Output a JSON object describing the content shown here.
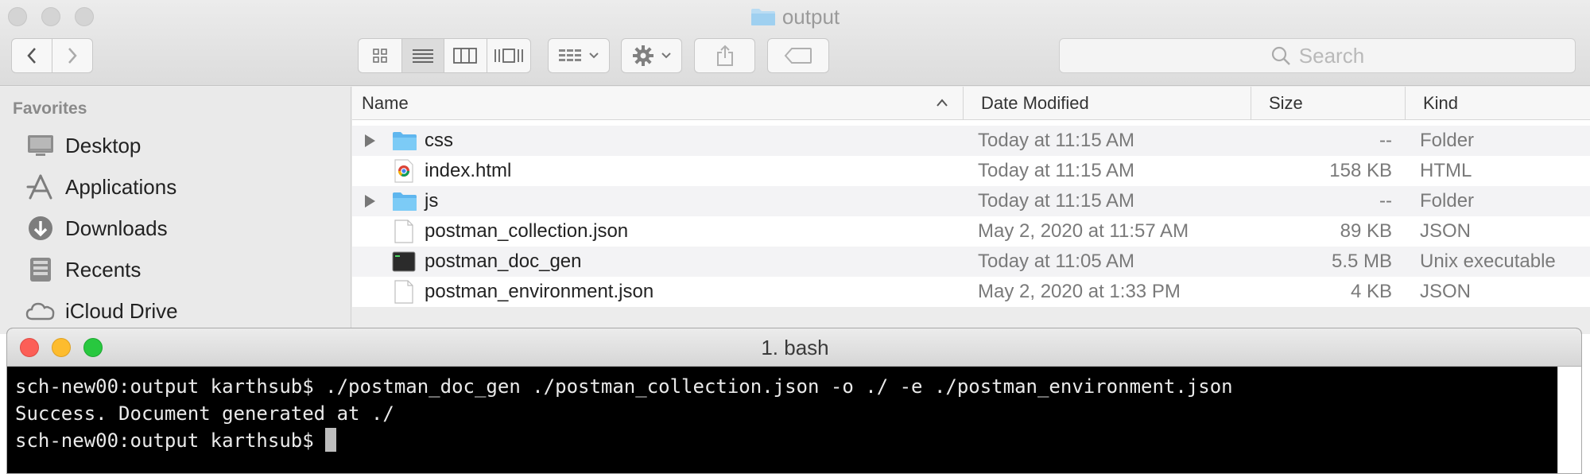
{
  "finder": {
    "title": "output",
    "search_placeholder": "Search",
    "sidebar": {
      "header": "Favorites",
      "items": [
        {
          "label": "Desktop",
          "icon": "desktop-icon"
        },
        {
          "label": "Applications",
          "icon": "applications-icon"
        },
        {
          "label": "Downloads",
          "icon": "downloads-icon"
        },
        {
          "label": "Recents",
          "icon": "recents-icon"
        },
        {
          "label": "iCloud Drive",
          "icon": "icloud-icon"
        }
      ]
    },
    "columns": {
      "name": "Name",
      "date": "Date Modified",
      "size": "Size",
      "kind": "Kind"
    },
    "files": [
      {
        "name": "css",
        "date": "Today at 11:15 AM",
        "size": "--",
        "kind": "Folder",
        "icon": "folder-icon",
        "expandable": true
      },
      {
        "name": "index.html",
        "date": "Today at 11:15 AM",
        "size": "158 KB",
        "kind": "HTML",
        "icon": "chrome-document-icon",
        "expandable": false
      },
      {
        "name": "js",
        "date": "Today at 11:15 AM",
        "size": "--",
        "kind": "Folder",
        "icon": "folder-icon",
        "expandable": true
      },
      {
        "name": "postman_collection.json",
        "date": "May 2, 2020 at 11:57 AM",
        "size": "89 KB",
        "kind": "JSON",
        "icon": "document-icon",
        "expandable": false
      },
      {
        "name": "postman_doc_gen",
        "date": "Today at 11:05 AM",
        "size": "5.5 MB",
        "kind": "Unix executable",
        "icon": "executable-icon",
        "expandable": false
      },
      {
        "name": "postman_environment.json",
        "date": "May 2, 2020 at 1:33 PM",
        "size": "4 KB",
        "kind": "JSON",
        "icon": "document-icon",
        "expandable": false
      }
    ]
  },
  "terminal": {
    "title": "1. bash",
    "lines": [
      "sch-new00:output karthsub$ ./postman_doc_gen ./postman_collection.json -o ./ -e ./postman_environment.json",
      "Success. Document generated at ./",
      "sch-new00:output karthsub$ "
    ]
  },
  "colors": {
    "folder": "#6cc1f5",
    "close": "#fc5f57",
    "minimize": "#fdbc2e",
    "zoom": "#28c83f",
    "terminal_bg": "#000000"
  }
}
